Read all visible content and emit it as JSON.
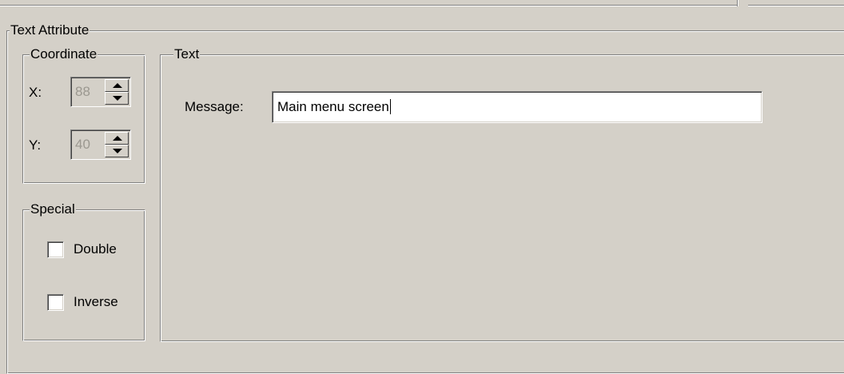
{
  "text_attribute": {
    "title": "Text Attribute",
    "coordinate": {
      "title": "Coordinate",
      "x_label": "X:",
      "x_value": "88",
      "y_label": "Y:",
      "y_value": "40"
    },
    "special": {
      "title": "Special",
      "double_label": "Double",
      "double_checked": false,
      "inverse_label": "Inverse",
      "inverse_checked": false
    },
    "text": {
      "title": "Text",
      "message_label": "Message:",
      "message_value": "Main menu screen"
    }
  },
  "icons": {
    "spin_up": "triangle-up-icon",
    "spin_down": "triangle-down-icon"
  },
  "colors": {
    "face": "#d4d0c8",
    "shadow": "#808080",
    "highlight": "#ffffff",
    "disabled_text": "#9b9890"
  }
}
